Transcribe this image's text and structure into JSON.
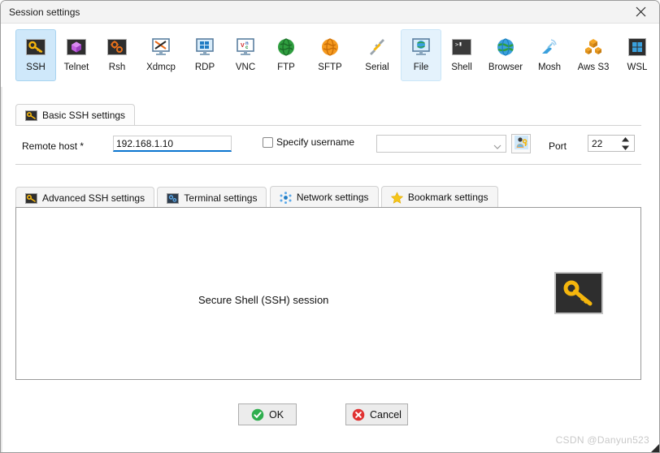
{
  "window": {
    "title": "Session settings",
    "close_icon": "close-icon"
  },
  "session_types": [
    {
      "label": "SSH",
      "icon": "ssh-key-icon",
      "state": "selected"
    },
    {
      "label": "Telnet",
      "icon": "telnet-cube-icon",
      "state": "normal"
    },
    {
      "label": "Rsh",
      "icon": "rsh-gears-icon",
      "state": "normal"
    },
    {
      "label": "Xdmcp",
      "icon": "xdmcp-monitor-icon",
      "state": "normal"
    },
    {
      "label": "RDP",
      "icon": "rdp-windows-icon",
      "state": "normal"
    },
    {
      "label": "VNC",
      "icon": "vnc-monitor-icon",
      "state": "normal"
    },
    {
      "label": "FTP",
      "icon": "ftp-globe-green-icon",
      "state": "normal"
    },
    {
      "label": "SFTP",
      "icon": "sftp-globe-orange-icon",
      "state": "normal"
    },
    {
      "label": "Serial",
      "icon": "serial-plug-icon",
      "state": "normal"
    },
    {
      "label": "File",
      "icon": "file-browser-icon",
      "state": "hovered"
    },
    {
      "label": "Shell",
      "icon": "shell-prompt-icon",
      "state": "normal"
    },
    {
      "label": "Browser",
      "icon": "browser-globe-icon",
      "state": "normal"
    },
    {
      "label": "Mosh",
      "icon": "mosh-satellite-icon",
      "state": "normal"
    },
    {
      "label": "Aws S3",
      "icon": "aws-s3-cubes-icon",
      "state": "normal"
    },
    {
      "label": "WSL",
      "icon": "wsl-windows-icon",
      "state": "normal"
    }
  ],
  "basic_tab": {
    "label": "Basic SSH settings",
    "icon": "ssh-key-icon",
    "remote_host": {
      "label": "Remote host *",
      "value": "192.168.1.10",
      "placeholder": ""
    },
    "specify_username": {
      "label": "Specify username",
      "checked": false,
      "combo_value": "",
      "combo_placeholder": "",
      "combo_arrow_icon": "chevron-down-icon",
      "picker_icon": "user-key-icon"
    },
    "port": {
      "label": "Port",
      "value": "22",
      "spinner_icon": "spinner-up-down-icon"
    }
  },
  "settings_tabs": [
    {
      "label": "Advanced SSH settings",
      "icon": "ssh-key-icon",
      "active": false
    },
    {
      "label": "Terminal settings",
      "icon": "terminal-gear-icon",
      "active": false
    },
    {
      "label": "Network settings",
      "icon": "network-dots-icon",
      "active": false
    },
    {
      "label": "Bookmark settings",
      "icon": "star-icon",
      "active": false
    }
  ],
  "content": {
    "description": "Secure Shell (SSH) session",
    "big_icon": "ssh-key-large-icon"
  },
  "footer": {
    "ok_label": "OK",
    "ok_icon": "check-circle-green-icon",
    "cancel_label": "Cancel",
    "cancel_icon": "x-circle-red-icon"
  },
  "watermark": "CSDN @Danyun523",
  "colors": {
    "selection_blue": "#cfe8fa",
    "focus_underline": "#0a74d0",
    "titlebar": "#f3f3f3",
    "ok_green": "#2eae4e",
    "cancel_red": "#e03131",
    "key_yellow": "#f5b60d"
  }
}
